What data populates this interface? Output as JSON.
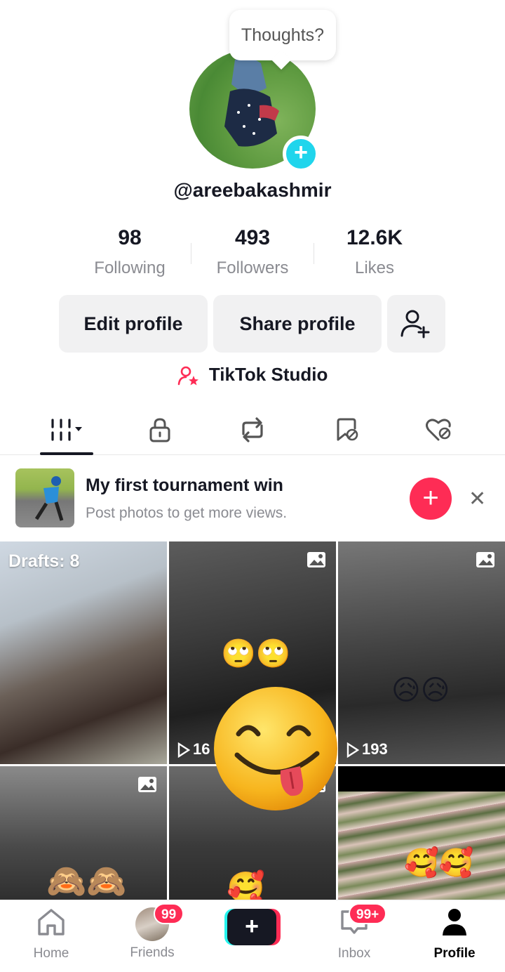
{
  "profile": {
    "thought_bubble": "Thoughts?",
    "username": "@areebakashmir"
  },
  "stats": [
    {
      "value": "98",
      "label": "Following"
    },
    {
      "value": "493",
      "label": "Followers"
    },
    {
      "value": "12.6K",
      "label": "Likes"
    }
  ],
  "buttons": {
    "edit": "Edit profile",
    "share": "Share profile",
    "add_friend_icon": "add-user-icon"
  },
  "studio": {
    "label": "TikTok Studio",
    "icon": "creator-star-icon"
  },
  "tabs": [
    {
      "icon": "videos-grid-icon",
      "active": true
    },
    {
      "icon": "lock-icon"
    },
    {
      "icon": "repost-icon"
    },
    {
      "icon": "favorites-icon"
    },
    {
      "icon": "liked-icon"
    }
  ],
  "promo": {
    "title": "My first tournament win",
    "subtitle": "Post photos to get more views.",
    "add_icon": "plus-icon",
    "close_icon": "close-icon"
  },
  "grid": [
    {
      "label": "Drafts: 8",
      "emoji": ""
    },
    {
      "views": "16",
      "emoji": "🙄🙄",
      "icon": "photo-icon"
    },
    {
      "views": "193",
      "emoji": "😥😥",
      "icon": "photo-icon"
    },
    {
      "emoji": "🙈🙈",
      "icon": "photo-icon"
    },
    {
      "emoji": "🥰",
      "icon": "photo-icon"
    },
    {
      "emoji": "🥰🥰"
    }
  ],
  "overlay_emoji": "😋",
  "nav": {
    "home": "Home",
    "friends": "Friends",
    "friends_badge": "99",
    "inbox": "Inbox",
    "inbox_badge": "99+",
    "profile": "Profile",
    "create_symbol": "+"
  },
  "colors": {
    "accent": "#fe2c55",
    "cyan": "#20d5ec",
    "text": "#161823"
  }
}
